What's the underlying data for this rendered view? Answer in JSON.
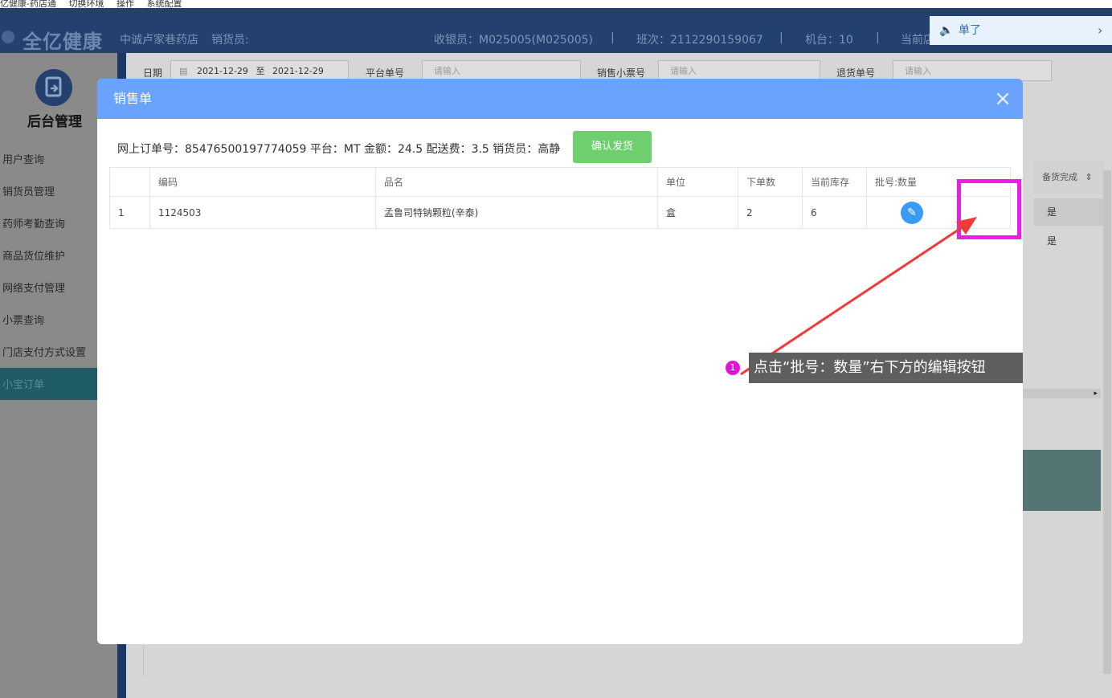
{
  "menubar": [
    "亿健康-药店通",
    "切换环境",
    "操作",
    "系统配置"
  ],
  "header": {
    "logo": "全亿健康",
    "store": "中诚卢家巷药店",
    "seller_label": "销货员:",
    "cashier": "收银员：M025005(M025005)",
    "shift": "班次：2112290159067",
    "register": "机台：10",
    "current": "当前店",
    "notice": "单了"
  },
  "sidebar": {
    "title": "后台管理",
    "items": [
      "用户查询",
      "销货员管理",
      "药师考勤查询",
      "商品货位维护",
      "网络支付管理",
      "小票查询",
      "门店支付方式设置",
      "小宝订单"
    ],
    "active": "小宝订单"
  },
  "filters": {
    "date_label": "日期",
    "date_from": "2021-12-29",
    "date_to_sep": "至",
    "date_to": "2021-12-29",
    "platform_label": "平台单号",
    "platform_placeholder": "请输入",
    "ticket_label": "销售小票号",
    "ticket_placeholder": "请输入",
    "return_label": "退货单号",
    "return_placeholder": "请输入"
  },
  "background_table": {
    "col_head": "备货完成",
    "rows": [
      "是",
      "是"
    ]
  },
  "modal": {
    "title": "销售单",
    "close": "×",
    "info": "网上订单号：85476500197774059  平台：MT  金额：24.5  配送费：3.5  销货员：高静",
    "confirm_button": "确认发货",
    "columns": [
      "",
      "编码",
      "品名",
      "单位",
      "下单数",
      "当前库存",
      "批号:数量"
    ],
    "rows": [
      {
        "idx": "1",
        "code": "1124503",
        "name": "孟鲁司特钠颗粒(辛泰)",
        "unit": "盒",
        "qty": "2",
        "stock": "6",
        "batch": ""
      }
    ]
  },
  "tooltip": {
    "step": "1",
    "text": "点击“批号：数量”右下方的编辑按钮"
  },
  "colors": {
    "header_bg": "#23406e",
    "modal_header": "#6aa2ff",
    "confirm_green": "#6ecf6e",
    "highlight": "#ec1de8",
    "arrow": "#f03a3a",
    "edit_blue": "#3a9bf7"
  },
  "icons": {
    "notice": "speaker-icon",
    "notice_chevron": "chevron-right-icon",
    "edit": "pencil-icon",
    "close": "close-icon",
    "calendar": "calendar-icon"
  }
}
